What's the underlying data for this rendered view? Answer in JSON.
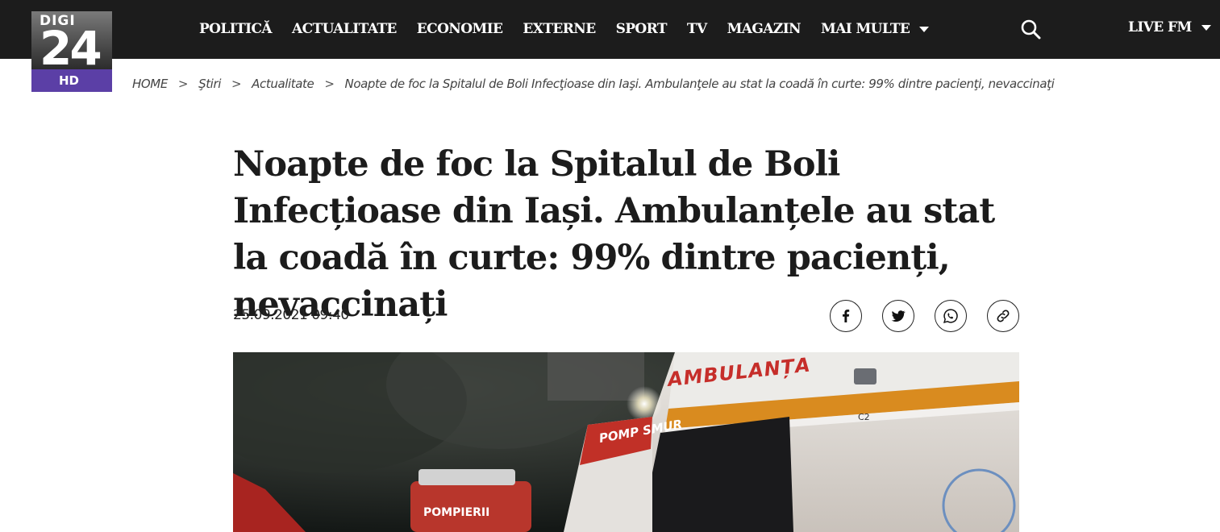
{
  "header": {
    "logo": {
      "text_top": "DIGI",
      "text_main": "24",
      "text_badge": "HD",
      "colors": {
        "badge": "#5b3fa6",
        "bar": "#1c1c1c"
      }
    },
    "nav": [
      {
        "label": "POLITICĂ"
      },
      {
        "label": "ACTUALITATE"
      },
      {
        "label": "ECONOMIE"
      },
      {
        "label": "EXTERNE"
      },
      {
        "label": "SPORT"
      },
      {
        "label": "TV"
      },
      {
        "label": "MAGAZIN"
      },
      {
        "label": "MAI MULTE",
        "dropdown": true
      }
    ],
    "search_icon": "search-icon",
    "live": {
      "label": "LIVE FM",
      "dropdown": true
    }
  },
  "breadcrumb": {
    "items": [
      {
        "label": "HOME"
      },
      {
        "label": "Ştiri"
      },
      {
        "label": "Actualitate"
      },
      {
        "label": "Noapte de foc la Spitalul de Boli Infecţioase din Iaşi. Ambulanţele au stat la coadă în curte: 99% dintre pacienţi, nevaccinaţi"
      }
    ],
    "separator": ">"
  },
  "article": {
    "title": "Noapte de foc la Spitalul de Boli Infecțioase din Iași. Ambulanțele au stat la coadă în curte: 99% dintre pacienți, nevaccinați",
    "date": "25.09.2021 09:40",
    "share": [
      {
        "icon": "facebook-icon"
      },
      {
        "icon": "twitter-icon"
      },
      {
        "icon": "whatsapp-icon"
      },
      {
        "icon": "link-icon"
      }
    ],
    "image": {
      "ambulance_text": "AMBULANȚA",
      "pompieri_text": "POMPIERII",
      "smurd_text": "POMP SMUR",
      "small_tag": "C2"
    }
  }
}
